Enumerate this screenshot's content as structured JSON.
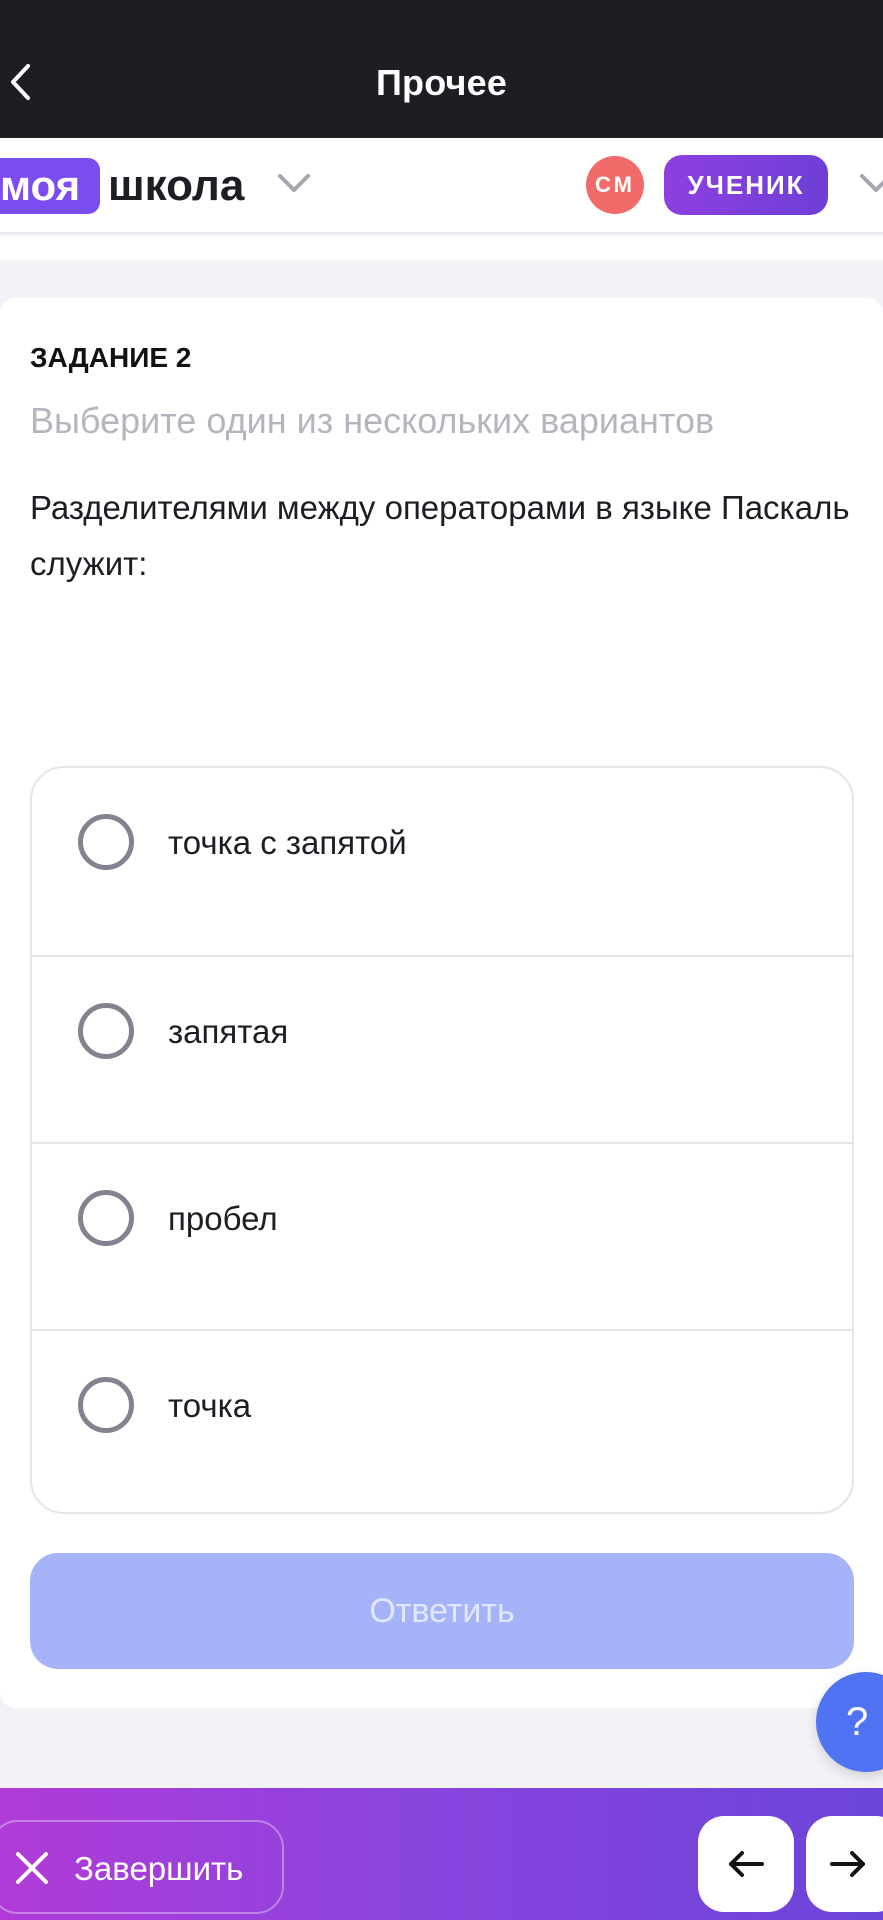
{
  "topbar": {
    "title": "Прочее"
  },
  "header": {
    "logo_part1": "моя",
    "logo_part2": "школа",
    "avatar_initials": "СМ",
    "role": "УЧЕНИК"
  },
  "task": {
    "label": "ЗАДАНИЕ 2",
    "hint": "Выберите один из нескольких вариантов",
    "question": "Разделителями между операторами в языке Паскаль служит:",
    "options": [
      {
        "label": "точка с запятой",
        "selected": false
      },
      {
        "label": "запятая",
        "selected": false
      },
      {
        "label": "пробел",
        "selected": false
      },
      {
        "label": "точка",
        "selected": false
      }
    ],
    "answer_label": "Ответить"
  },
  "help": {
    "label": "?"
  },
  "footer": {
    "finish_label": "Завершить"
  },
  "colors": {
    "topbar_bg": "#1e1d24",
    "brand_purple": "#7b4df0",
    "avatar_red": "#f26b6b",
    "answer_disabled": "#a5b4f8",
    "help_blue": "#4f73f2"
  }
}
